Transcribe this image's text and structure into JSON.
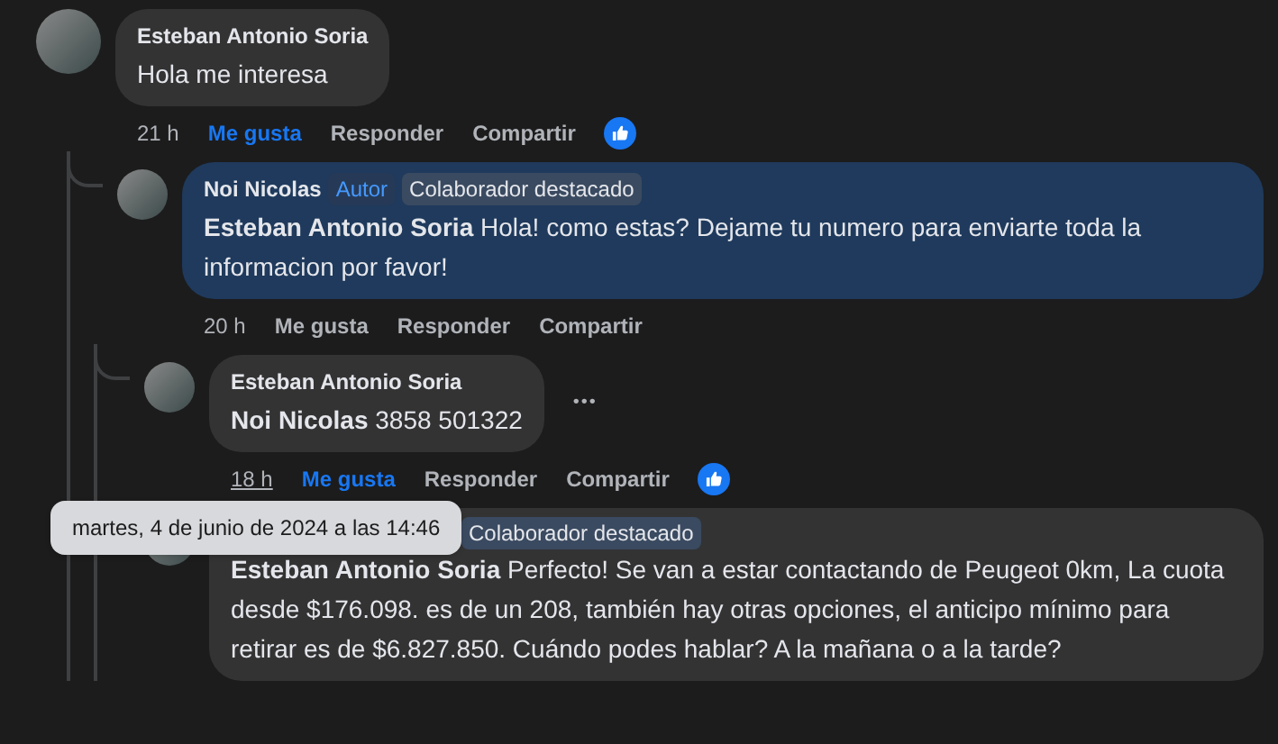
{
  "comments": [
    {
      "author": "Esteban Antonio Soria",
      "text": "Hola me interesa",
      "highlighted": false,
      "time": "21 h",
      "time_hovered": false,
      "actions": [
        {
          "label": "Me gusta",
          "liked": true
        },
        {
          "label": "Responder"
        },
        {
          "label": "Compartir"
        }
      ],
      "reaction": true,
      "children": [
        {
          "author": "Noi Nicolas",
          "badges": [
            {
              "label": "Autor",
              "kind": "author"
            },
            {
              "label": "Colaborador destacado",
              "kind": "top"
            }
          ],
          "text": "**Esteban Antonio Soria** Hola! como estas? Dejame tu numero para enviarte toda la informacion por favor!",
          "highlighted": true,
          "time": "20 h",
          "time_hovered": false,
          "actions": [
            {
              "label": "Me gusta",
              "liked": false
            },
            {
              "label": "Responder"
            },
            {
              "label": "Compartir"
            }
          ],
          "children": [
            {
              "author": "Esteban Antonio Soria",
              "text": "**Noi Nicolas** 3858 501322",
              "highlighted": false,
              "more": "•••",
              "time": "18 h",
              "time_hovered": true,
              "actions": [
                {
                  "label": "Me gusta",
                  "liked": true
                },
                {
                  "label": "Responder"
                },
                {
                  "label": "Compartir"
                }
              ],
              "reaction": true
            },
            {
              "badges": [
                {
                  "label": "Colaborador destacado",
                  "kind": "top"
                }
              ],
              "text": "**Esteban Antonio Soria** Perfecto! Se van a estar contactando de Peugeot 0km, La cuota desde $176.098. es de un 208, también hay otras opciones, el anticipo mínimo para retirar es de $6.827.850. Cuándo podes hablar? A la mañana o a la tarde?",
              "highlighted": false,
              "tooltip": "martes, 4 de junio de 2024 a las 14:46"
            }
          ]
        }
      ]
    }
  ]
}
